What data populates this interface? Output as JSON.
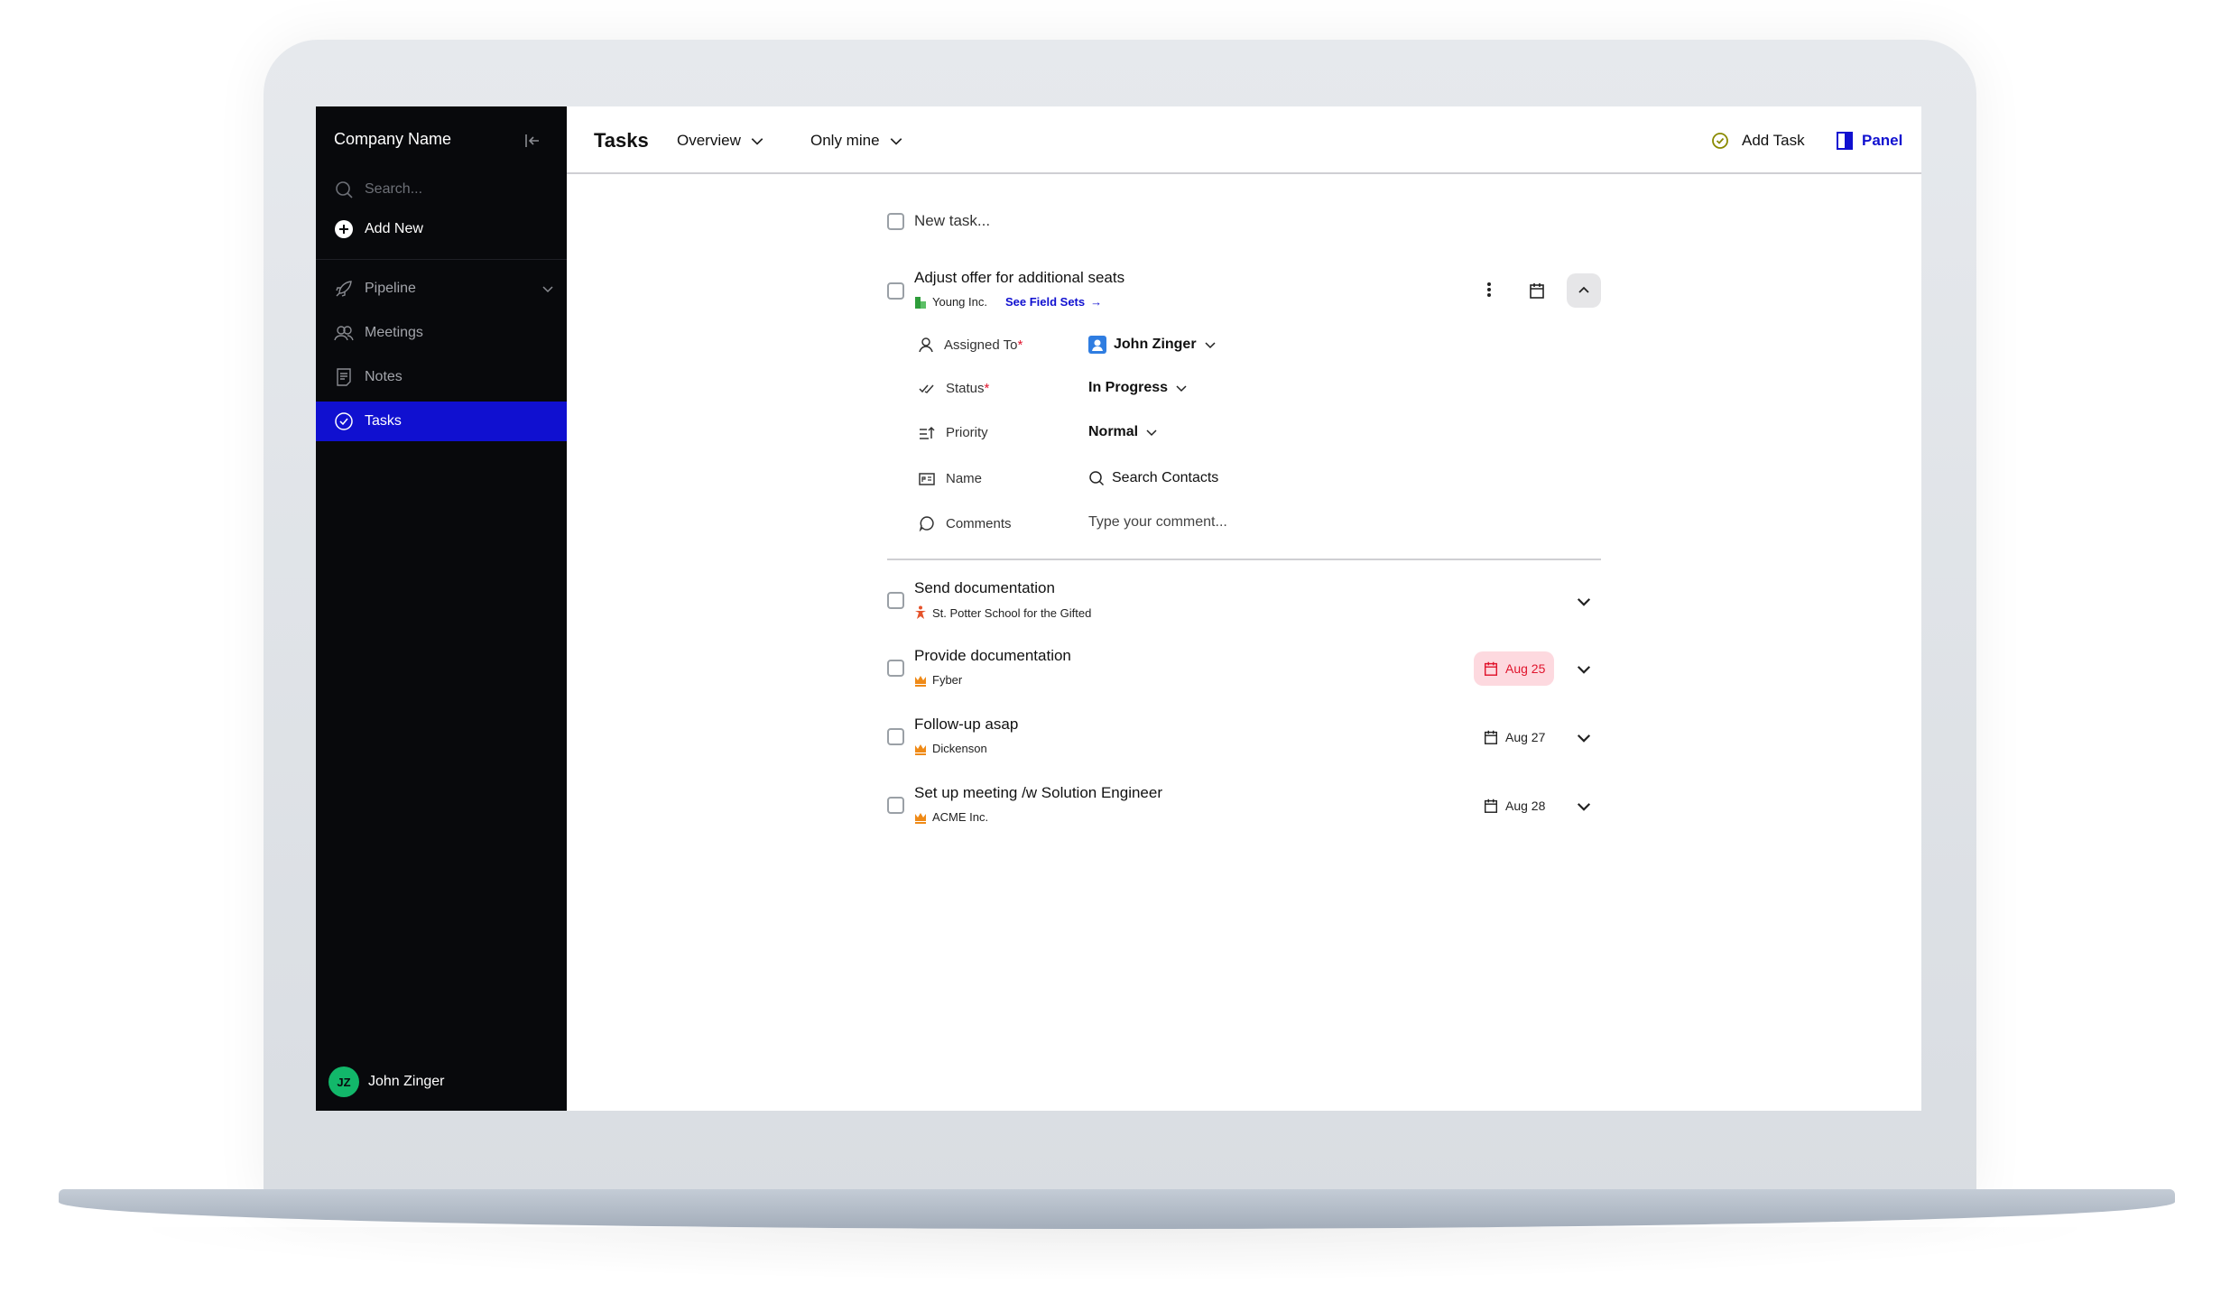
{
  "sidebar": {
    "company": "Company Name",
    "search_placeholder": "Search...",
    "add_new": "Add New",
    "items": [
      {
        "label": "Pipeline"
      },
      {
        "label": "Meetings"
      },
      {
        "label": "Notes"
      },
      {
        "label": "Tasks"
      }
    ],
    "user": {
      "initials": "JZ",
      "name": "John Zinger"
    }
  },
  "header": {
    "title": "Tasks",
    "view": "Overview",
    "filter": "Only mine",
    "add_task": "Add Task",
    "panel": "Panel"
  },
  "new_task_placeholder": "New task...",
  "expanded_task": {
    "title": "Adjust offer for additional seats",
    "company": "Young Inc.",
    "link": "See Field Sets",
    "fields": [
      {
        "label": "Assigned To",
        "required": "*",
        "value": "John Zinger"
      },
      {
        "label": "Status",
        "required": "*",
        "value": "In Progress"
      },
      {
        "label": "Priority",
        "value": "Normal"
      },
      {
        "label": "Name",
        "value": "Search Contacts"
      },
      {
        "label": "Comments",
        "placeholder": "Type your comment..."
      }
    ]
  },
  "tasks": [
    {
      "title": "Send documentation",
      "company": "St. Potter School for the Gifted"
    },
    {
      "title": "Provide documentation",
      "company": "Fyber",
      "date": "Aug 25",
      "overdue": true
    },
    {
      "title": "Follow-up asap",
      "company": "Dickenson",
      "date": "Aug 27"
    },
    {
      "title": "Set up meeting /w Solution Engineer",
      "company": "ACME Inc.",
      "date": "Aug 28"
    }
  ],
  "colors": {
    "accent": "#1010d0",
    "sidebar": "#08090c",
    "overdue_bg": "#fdd9df",
    "overdue_text": "#e0142c",
    "avatar": "#12b76a"
  }
}
